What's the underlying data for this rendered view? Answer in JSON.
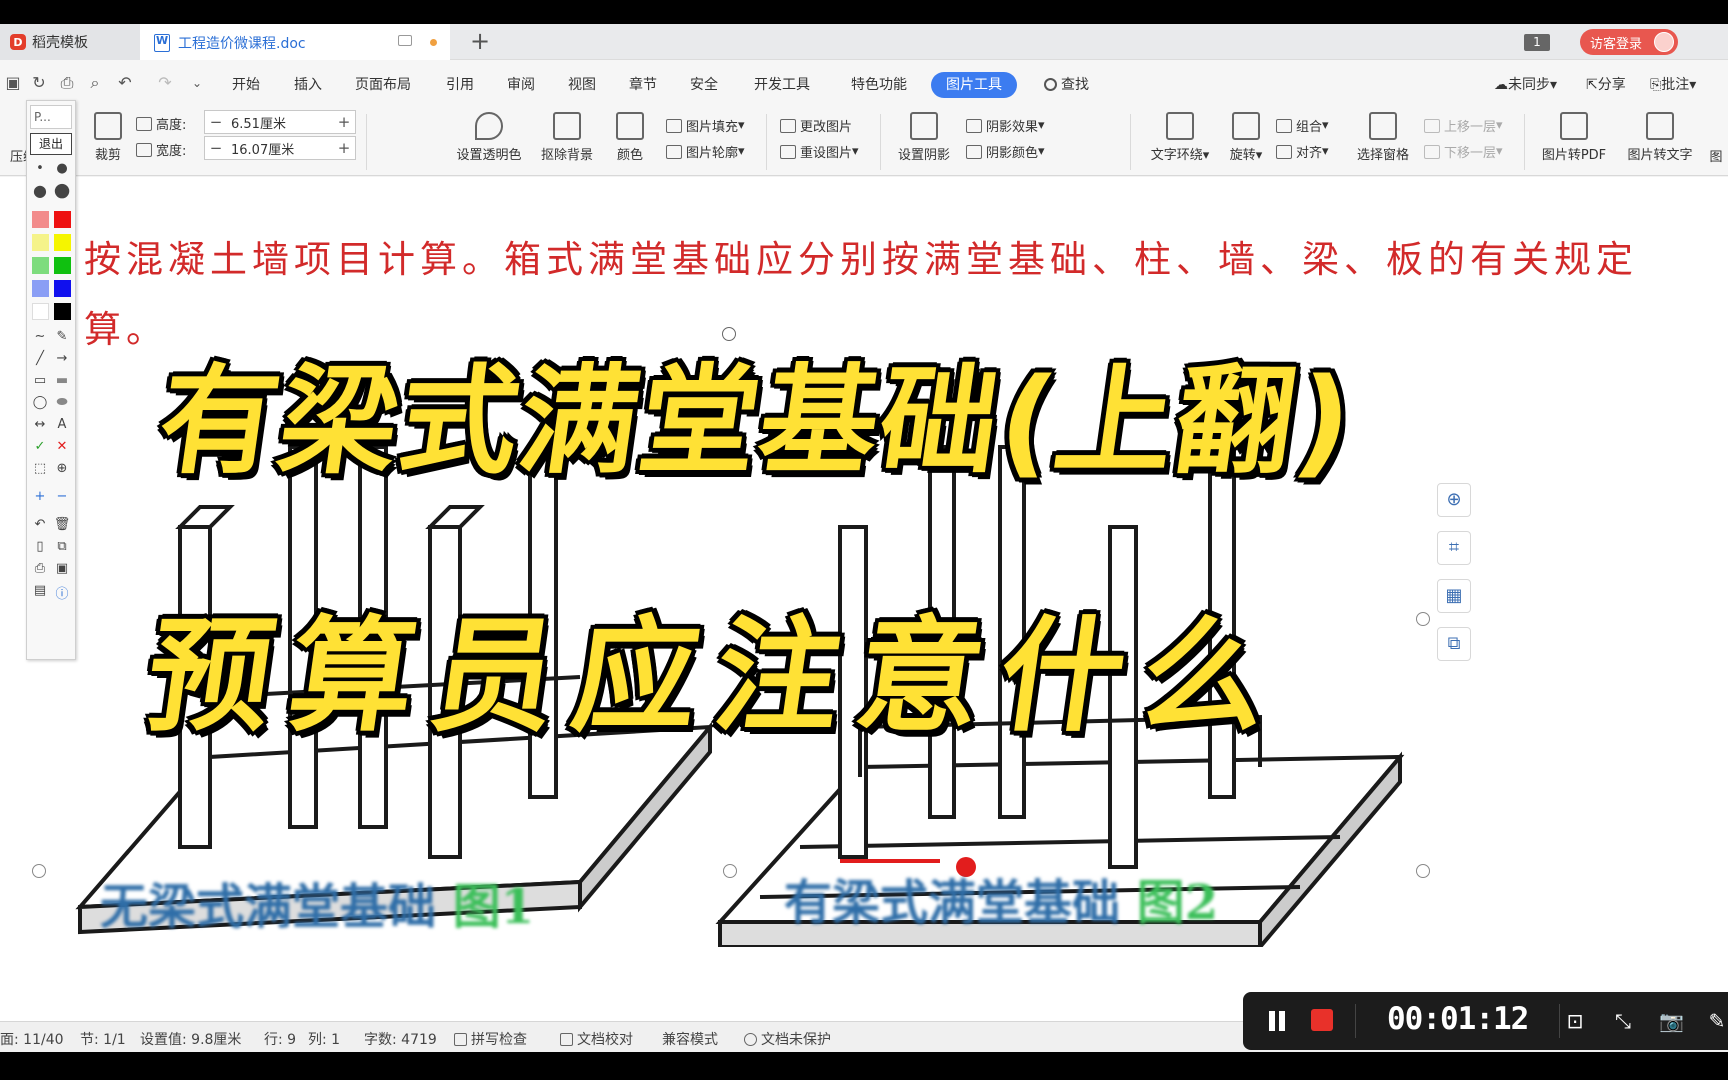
{
  "tabs": {
    "home_label": "稻壳模板",
    "doc_label": "工程造价微课程.doc",
    "window_badge": "1",
    "login_label": "访客登录"
  },
  "menu": {
    "items": [
      "开始",
      "插入",
      "页面布局",
      "引用",
      "审阅",
      "视图",
      "章节",
      "安全",
      "开发工具",
      "特色功能"
    ],
    "active": "图片工具",
    "search": "查找",
    "sync": "未同步",
    "share": "分享",
    "comment": "批注"
  },
  "ribbon": {
    "compress": "压缩",
    "crop": "裁剪",
    "height_label": "高度:",
    "height_value": "6.51厘米",
    "width_label": "宽度:",
    "width_value": "16.07厘米",
    "transparent": "设置透明色",
    "remove_bg": "抠除背景",
    "color": "颜色",
    "fill": "图片填充",
    "outline": "图片轮廓",
    "change_pic": "更改图片",
    "reset_pic": "重设图片",
    "shadow": "设置阴影",
    "shadow_effect": "阴影效果",
    "shadow_color": "阴影颜色",
    "wrap": "文字环绕",
    "rotate": "旋转",
    "group": "组合",
    "align": "对齐",
    "select_pane": "选择窗格",
    "up_layer": "上移一层",
    "down_layer": "下移一层",
    "to_pdf": "图片转PDF",
    "to_text": "图片转文字",
    "more": "图"
  },
  "document": {
    "line1": "按混凝土墙项目计算。箱式满堂基础应分别按满堂基础、柱、墙、梁、板的有关规定",
    "line2": "算。",
    "caption1": "无梁式满堂基础",
    "caption1_fig": "图1",
    "caption2": "有梁式满堂基础",
    "caption2_fig": "图2"
  },
  "overlay": {
    "title1": "有梁式满堂基础(上翻)",
    "title2": "预算员应注意什么"
  },
  "palette": {
    "input": "P...",
    "exit": "退出",
    "text_tool": "A"
  },
  "status": {
    "page": "面: 11/40",
    "section": "节: 1/1",
    "setting": "设置值: 9.8厘米",
    "row": "行: 9",
    "col": "列: 1",
    "words": "字数: 4719",
    "spell": "拼写检查",
    "proof": "文档校对",
    "compat": "兼容模式",
    "protect": "文档未保护"
  },
  "recorder": {
    "time": "00:01:12"
  },
  "colors": {
    "accent": "#3c7cf0",
    "text_red": "#d22a2a",
    "title_yellow": "#ffe135",
    "caption_blue": "#2f6ea8",
    "caption_green": "#3cbf5a",
    "record_red": "#e8312a"
  }
}
